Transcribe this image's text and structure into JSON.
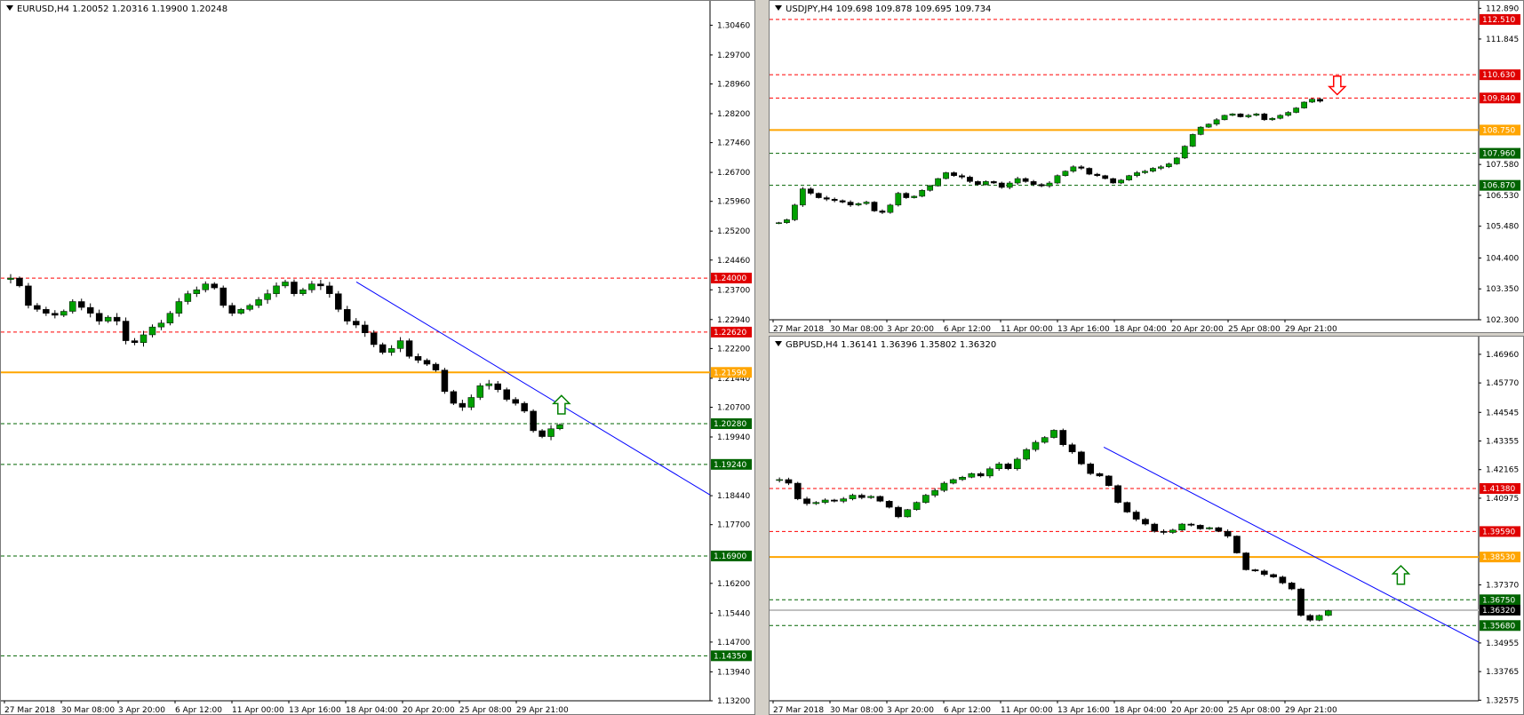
{
  "panels": {
    "eurusd": {
      "title": "EURUSD,H4  1.20052 1.20316 1.19900 1.20248",
      "ylim": [
        1.132,
        1.309
      ],
      "y_ticks": [
        "1.30460",
        "1.29700",
        "1.28960",
        "1.28200",
        "1.27460",
        "1.26700",
        "1.25960",
        "1.25200",
        "1.24460",
        "1.23700",
        "1.22940",
        "1.22200",
        "1.21440",
        "1.20700",
        "1.19940",
        "1.18440",
        "1.17700",
        "1.16200",
        "1.15440",
        "1.14700",
        "1.13940",
        "1.13200"
      ],
      "x_ticks": [
        "27 Mar 2018",
        "30 Mar 08:00",
        "3 Apr 20:00",
        "6 Apr 12:00",
        "11 Apr 00:00",
        "13 Apr 16:00",
        "18 Apr 04:00",
        "20 Apr 20:00",
        "25 Apr 08:00",
        "29 Apr 21:00"
      ]
    },
    "usdjpy": {
      "title": "USDJPY,H4  109.698 109.878 109.695 109.734",
      "ylim": [
        102.3,
        112.9
      ],
      "y_ticks": [
        "112.890",
        "111.845",
        "107.580",
        "106.530",
        "105.480",
        "104.400",
        "103.350",
        "102.300"
      ],
      "x_ticks": [
        "27 Mar 2018",
        "30 Mar 08:00",
        "3 Apr 20:00",
        "6 Apr 12:00",
        "11 Apr 00:00",
        "13 Apr 16:00",
        "18 Apr 04:00",
        "20 Apr 20:00",
        "25 Apr 08:00",
        "29 Apr 21:00"
      ]
    },
    "gbpusd": {
      "title": "GBPUSD,H4  1.36141 1.36396 1.35802 1.36320",
      "ylim": [
        1.3255,
        1.474
      ],
      "y_ticks": [
        "1.46960",
        "1.45770",
        "1.44545",
        "1.43355",
        "1.42165",
        "1.40975",
        "1.37370",
        "1.34955",
        "1.33765",
        "1.32575"
      ],
      "x_ticks": [
        "27 Mar 2018",
        "30 Mar 08:00",
        "3 Apr 20:00",
        "6 Apr 12:00",
        "11 Apr 00:00",
        "13 Apr 16:00",
        "18 Apr 04:00",
        "20 Apr 20:00",
        "25 Apr 08:00",
        "29 Apr 21:00"
      ]
    }
  },
  "chart_data": [
    {
      "type": "candlestick",
      "symbol": "EURUSD",
      "timeframe": "H4",
      "title": "EURUSD,H4  1.20052 1.20316 1.19900 1.20248",
      "ylim": [
        1.132,
        1.309
      ],
      "grid": false,
      "levels": [
        {
          "price": 1.24,
          "label": "1.24000",
          "style": "dashed",
          "color": "#ff0000"
        },
        {
          "price": 1.2262,
          "label": "1.22620",
          "style": "dashed",
          "color": "#ff0000"
        },
        {
          "price": 1.2159,
          "label": "1.21590",
          "style": "solid",
          "color": "#ffa500"
        },
        {
          "price": 1.2028,
          "label": "1.20280",
          "style": "dashed",
          "color": "#006400"
        },
        {
          "price": 1.1924,
          "label": "1.19240",
          "style": "dashed",
          "color": "#006400"
        },
        {
          "price": 1.169,
          "label": "1.16900",
          "style": "dashed",
          "color": "#006400"
        },
        {
          "price": 1.1435,
          "label": "1.14350",
          "style": "dashed",
          "color": "#006400"
        }
      ],
      "trendline": {
        "from": [
          0.5,
          1.239
        ],
        "to": [
          1.0,
          1.1846
        ],
        "color": "#0000ff"
      },
      "arrow": {
        "direction": "up",
        "color": "#008000",
        "at": [
          0.79,
          1.2059
        ]
      },
      "price_path": [
        1.24,
        1.238,
        1.233,
        1.232,
        1.231,
        1.2305,
        1.2315,
        1.234,
        1.2325,
        1.231,
        1.229,
        1.23,
        1.229,
        1.224,
        1.2235,
        1.2255,
        1.2275,
        1.2285,
        1.231,
        1.234,
        1.236,
        1.237,
        1.2385,
        1.2375,
        1.233,
        1.231,
        1.232,
        1.233,
        1.2345,
        1.236,
        1.238,
        1.239,
        1.236,
        1.237,
        1.2385,
        1.238,
        1.236,
        1.232,
        1.229,
        1.228,
        1.226,
        1.223,
        1.221,
        1.222,
        1.224,
        1.22,
        1.219,
        1.218,
        1.2165,
        1.211,
        1.208,
        1.207,
        1.2095,
        1.2125,
        1.213,
        1.2115,
        1.209,
        1.208,
        1.206,
        1.201,
        1.1995,
        1.2015,
        1.2025
      ]
    },
    {
      "type": "candlestick",
      "symbol": "USDJPY",
      "timeframe": "H4",
      "title": "USDJPY,H4  109.698 109.878 109.695 109.734",
      "ylim": [
        102.3,
        112.9
      ],
      "grid": false,
      "levels": [
        {
          "price": 112.51,
          "label": "112.510",
          "style": "dashed",
          "color": "#ff0000"
        },
        {
          "price": 110.63,
          "label": "110.630",
          "style": "dashed",
          "color": "#ff0000"
        },
        {
          "price": 109.84,
          "label": "109.840",
          "style": "dashed",
          "color": "#ff0000"
        },
        {
          "price": 108.75,
          "label": "108.750",
          "style": "solid",
          "color": "#ffa500"
        },
        {
          "price": 107.96,
          "label": "107.960",
          "style": "dashed",
          "color": "#006400"
        },
        {
          "price": 106.87,
          "label": "106.870",
          "style": "dashed",
          "color": "#006400"
        }
      ],
      "arrow": {
        "direction": "down",
        "color": "#ff0000",
        "at": [
          0.8,
          110.5
        ]
      },
      "price_path": [
        105.6,
        105.7,
        106.2,
        106.75,
        106.6,
        106.45,
        106.4,
        106.35,
        106.3,
        106.2,
        106.25,
        106.3,
        106.0,
        105.95,
        106.2,
        106.6,
        106.45,
        106.5,
        106.7,
        106.85,
        107.1,
        107.3,
        107.2,
        107.15,
        107.0,
        106.9,
        107.0,
        106.95,
        106.8,
        106.95,
        107.1,
        107.0,
        106.9,
        106.85,
        106.95,
        107.2,
        107.35,
        107.5,
        107.45,
        107.25,
        107.2,
        107.1,
        106.95,
        107.05,
        107.2,
        107.3,
        107.35,
        107.45,
        107.5,
        107.6,
        107.8,
        108.2,
        108.6,
        108.85,
        108.95,
        109.1,
        109.25,
        109.3,
        109.2,
        109.25,
        109.3,
        109.1,
        109.15,
        109.25,
        109.35,
        109.5,
        109.7,
        109.8,
        109.73
      ]
    },
    {
      "type": "candlestick",
      "symbol": "GBPUSD",
      "timeframe": "H4",
      "title": "GBPUSD,H4  1.36141 1.36396 1.35802 1.36320",
      "ylim": [
        1.3255,
        1.474
      ],
      "grid": false,
      "levels": [
        {
          "price": 1.4138,
          "label": "1.41380",
          "style": "dashed",
          "color": "#ff0000"
        },
        {
          "price": 1.3959,
          "label": "1.39590",
          "style": "dashed",
          "color": "#ff0000"
        },
        {
          "price": 1.3853,
          "label": "1.38530",
          "style": "solid",
          "color": "#ffa500"
        },
        {
          "price": 1.3675,
          "label": "1.36750",
          "style": "dashed",
          "color": "#006400"
        },
        {
          "price": 1.3632,
          "label": "1.36320",
          "style": "solid",
          "color": "#c0c0c0"
        },
        {
          "price": 1.3568,
          "label": "1.35680",
          "style": "dashed",
          "color": "#006400"
        }
      ],
      "trendline": {
        "from": [
          0.47,
          1.431
        ],
        "to": [
          1.0,
          1.3499
        ],
        "color": "#0000ff"
      },
      "arrow": {
        "direction": "up",
        "color": "#008000",
        "at": [
          0.89,
          1.375
        ]
      },
      "price_path": [
        1.4175,
        1.416,
        1.4095,
        1.4075,
        1.408,
        1.409,
        1.4085,
        1.4095,
        1.411,
        1.41,
        1.4105,
        1.4085,
        1.406,
        1.402,
        1.405,
        1.408,
        1.411,
        1.413,
        1.416,
        1.4175,
        1.4185,
        1.42,
        1.419,
        1.422,
        1.424,
        1.422,
        1.426,
        1.43,
        1.433,
        1.435,
        1.438,
        1.432,
        1.429,
        1.424,
        1.42,
        1.419,
        1.415,
        1.408,
        1.404,
        1.401,
        1.399,
        1.396,
        1.3955,
        1.3965,
        1.399,
        1.3985,
        1.397,
        1.3975,
        1.396,
        1.394,
        1.387,
        1.38,
        1.3795,
        1.378,
        1.377,
        1.3745,
        1.372,
        1.361,
        1.359,
        1.361,
        1.363
      ]
    }
  ],
  "colors": {
    "bull_candle": "#00a000",
    "bear_candle": "#000000",
    "resistance": "#ff0000",
    "support": "#006400",
    "pivot": "#ffa500",
    "trendline": "#0000ff",
    "axis_text": "#000000"
  }
}
